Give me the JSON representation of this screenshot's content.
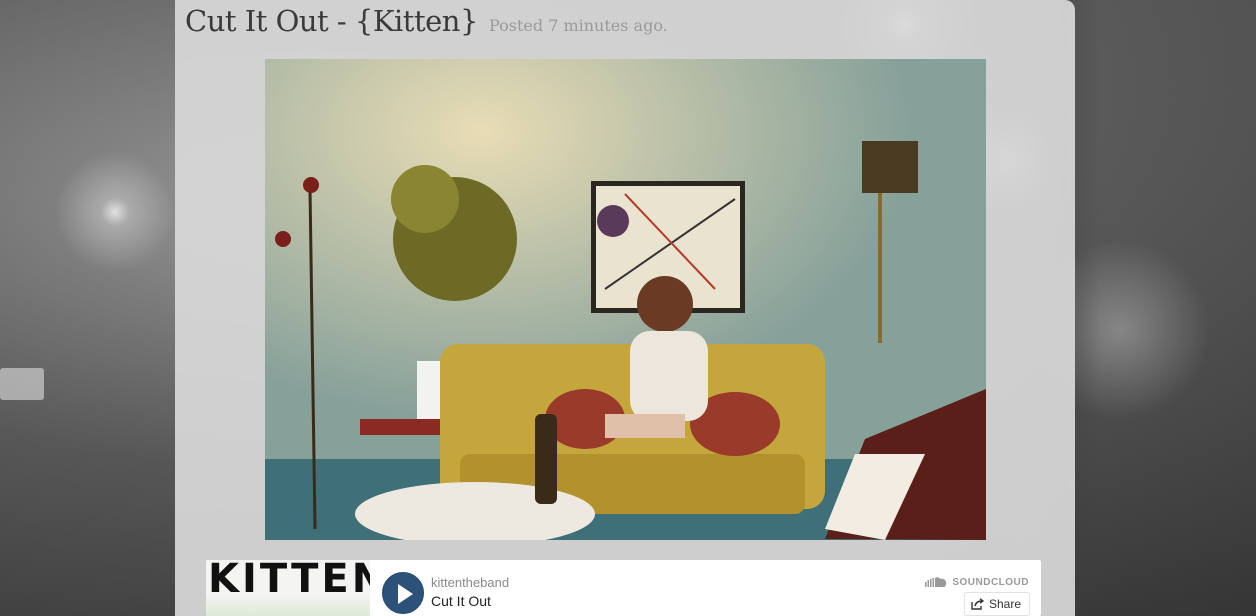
{
  "post": {
    "title": "Cut It Out - {Kitten}",
    "posted": "Posted 7 minutes ago."
  },
  "photo": {
    "alt_icon": "photo-image"
  },
  "soundcloud": {
    "artwork_text": "KITTEN",
    "user": "kittentheband",
    "track": "Cut It Out",
    "brand": "SOUNDCLOUD",
    "share_label": "Share",
    "play_color": "#2d5279"
  }
}
